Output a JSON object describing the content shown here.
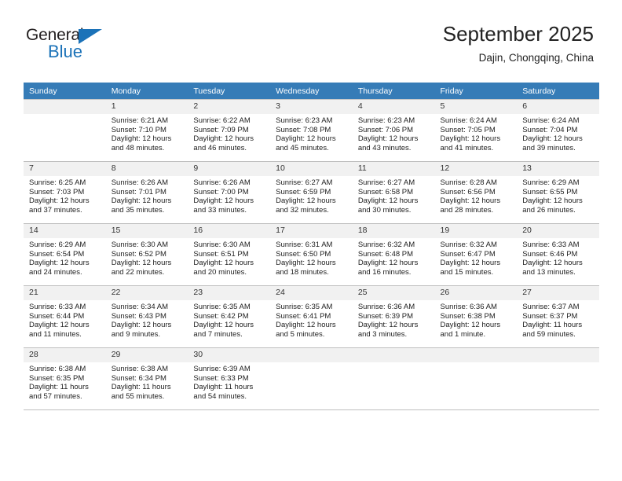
{
  "brand": {
    "name_part1": "General",
    "name_part2": "Blue"
  },
  "header": {
    "title": "September 2025",
    "subtitle": "Dajin, Chongqing, China"
  },
  "weekdays": [
    "Sunday",
    "Monday",
    "Tuesday",
    "Wednesday",
    "Thursday",
    "Friday",
    "Saturday"
  ],
  "labels": {
    "sunrise_prefix": "Sunrise: ",
    "sunset_prefix": "Sunset: ",
    "daylight_prefix": "Daylight: "
  },
  "colors": {
    "header_bar": "#367cb7",
    "brand_blue": "#1b72b8",
    "daynum_bg": "#f1f1f1",
    "grid_line": "#bfbfbf"
  },
  "weeks": [
    [
      {
        "empty": true
      },
      {
        "day": "1",
        "sunrise": "Sunrise: 6:21 AM",
        "sunset": "Sunset: 7:10 PM",
        "daylight_l1": "Daylight: 12 hours",
        "daylight_l2": "and 48 minutes."
      },
      {
        "day": "2",
        "sunrise": "Sunrise: 6:22 AM",
        "sunset": "Sunset: 7:09 PM",
        "daylight_l1": "Daylight: 12 hours",
        "daylight_l2": "and 46 minutes."
      },
      {
        "day": "3",
        "sunrise": "Sunrise: 6:23 AM",
        "sunset": "Sunset: 7:08 PM",
        "daylight_l1": "Daylight: 12 hours",
        "daylight_l2": "and 45 minutes."
      },
      {
        "day": "4",
        "sunrise": "Sunrise: 6:23 AM",
        "sunset": "Sunset: 7:06 PM",
        "daylight_l1": "Daylight: 12 hours",
        "daylight_l2": "and 43 minutes."
      },
      {
        "day": "5",
        "sunrise": "Sunrise: 6:24 AM",
        "sunset": "Sunset: 7:05 PM",
        "daylight_l1": "Daylight: 12 hours",
        "daylight_l2": "and 41 minutes."
      },
      {
        "day": "6",
        "sunrise": "Sunrise: 6:24 AM",
        "sunset": "Sunset: 7:04 PM",
        "daylight_l1": "Daylight: 12 hours",
        "daylight_l2": "and 39 minutes."
      }
    ],
    [
      {
        "day": "7",
        "sunrise": "Sunrise: 6:25 AM",
        "sunset": "Sunset: 7:03 PM",
        "daylight_l1": "Daylight: 12 hours",
        "daylight_l2": "and 37 minutes."
      },
      {
        "day": "8",
        "sunrise": "Sunrise: 6:26 AM",
        "sunset": "Sunset: 7:01 PM",
        "daylight_l1": "Daylight: 12 hours",
        "daylight_l2": "and 35 minutes."
      },
      {
        "day": "9",
        "sunrise": "Sunrise: 6:26 AM",
        "sunset": "Sunset: 7:00 PM",
        "daylight_l1": "Daylight: 12 hours",
        "daylight_l2": "and 33 minutes."
      },
      {
        "day": "10",
        "sunrise": "Sunrise: 6:27 AM",
        "sunset": "Sunset: 6:59 PM",
        "daylight_l1": "Daylight: 12 hours",
        "daylight_l2": "and 32 minutes."
      },
      {
        "day": "11",
        "sunrise": "Sunrise: 6:27 AM",
        "sunset": "Sunset: 6:58 PM",
        "daylight_l1": "Daylight: 12 hours",
        "daylight_l2": "and 30 minutes."
      },
      {
        "day": "12",
        "sunrise": "Sunrise: 6:28 AM",
        "sunset": "Sunset: 6:56 PM",
        "daylight_l1": "Daylight: 12 hours",
        "daylight_l2": "and 28 minutes."
      },
      {
        "day": "13",
        "sunrise": "Sunrise: 6:29 AM",
        "sunset": "Sunset: 6:55 PM",
        "daylight_l1": "Daylight: 12 hours",
        "daylight_l2": "and 26 minutes."
      }
    ],
    [
      {
        "day": "14",
        "sunrise": "Sunrise: 6:29 AM",
        "sunset": "Sunset: 6:54 PM",
        "daylight_l1": "Daylight: 12 hours",
        "daylight_l2": "and 24 minutes."
      },
      {
        "day": "15",
        "sunrise": "Sunrise: 6:30 AM",
        "sunset": "Sunset: 6:52 PM",
        "daylight_l1": "Daylight: 12 hours",
        "daylight_l2": "and 22 minutes."
      },
      {
        "day": "16",
        "sunrise": "Sunrise: 6:30 AM",
        "sunset": "Sunset: 6:51 PM",
        "daylight_l1": "Daylight: 12 hours",
        "daylight_l2": "and 20 minutes."
      },
      {
        "day": "17",
        "sunrise": "Sunrise: 6:31 AM",
        "sunset": "Sunset: 6:50 PM",
        "daylight_l1": "Daylight: 12 hours",
        "daylight_l2": "and 18 minutes."
      },
      {
        "day": "18",
        "sunrise": "Sunrise: 6:32 AM",
        "sunset": "Sunset: 6:48 PM",
        "daylight_l1": "Daylight: 12 hours",
        "daylight_l2": "and 16 minutes."
      },
      {
        "day": "19",
        "sunrise": "Sunrise: 6:32 AM",
        "sunset": "Sunset: 6:47 PM",
        "daylight_l1": "Daylight: 12 hours",
        "daylight_l2": "and 15 minutes."
      },
      {
        "day": "20",
        "sunrise": "Sunrise: 6:33 AM",
        "sunset": "Sunset: 6:46 PM",
        "daylight_l1": "Daylight: 12 hours",
        "daylight_l2": "and 13 minutes."
      }
    ],
    [
      {
        "day": "21",
        "sunrise": "Sunrise: 6:33 AM",
        "sunset": "Sunset: 6:44 PM",
        "daylight_l1": "Daylight: 12 hours",
        "daylight_l2": "and 11 minutes."
      },
      {
        "day": "22",
        "sunrise": "Sunrise: 6:34 AM",
        "sunset": "Sunset: 6:43 PM",
        "daylight_l1": "Daylight: 12 hours",
        "daylight_l2": "and 9 minutes."
      },
      {
        "day": "23",
        "sunrise": "Sunrise: 6:35 AM",
        "sunset": "Sunset: 6:42 PM",
        "daylight_l1": "Daylight: 12 hours",
        "daylight_l2": "and 7 minutes."
      },
      {
        "day": "24",
        "sunrise": "Sunrise: 6:35 AM",
        "sunset": "Sunset: 6:41 PM",
        "daylight_l1": "Daylight: 12 hours",
        "daylight_l2": "and 5 minutes."
      },
      {
        "day": "25",
        "sunrise": "Sunrise: 6:36 AM",
        "sunset": "Sunset: 6:39 PM",
        "daylight_l1": "Daylight: 12 hours",
        "daylight_l2": "and 3 minutes."
      },
      {
        "day": "26",
        "sunrise": "Sunrise: 6:36 AM",
        "sunset": "Sunset: 6:38 PM",
        "daylight_l1": "Daylight: 12 hours",
        "daylight_l2": "and 1 minute."
      },
      {
        "day": "27",
        "sunrise": "Sunrise: 6:37 AM",
        "sunset": "Sunset: 6:37 PM",
        "daylight_l1": "Daylight: 11 hours",
        "daylight_l2": "and 59 minutes."
      }
    ],
    [
      {
        "day": "28",
        "sunrise": "Sunrise: 6:38 AM",
        "sunset": "Sunset: 6:35 PM",
        "daylight_l1": "Daylight: 11 hours",
        "daylight_l2": "and 57 minutes."
      },
      {
        "day": "29",
        "sunrise": "Sunrise: 6:38 AM",
        "sunset": "Sunset: 6:34 PM",
        "daylight_l1": "Daylight: 11 hours",
        "daylight_l2": "and 55 minutes."
      },
      {
        "day": "30",
        "sunrise": "Sunrise: 6:39 AM",
        "sunset": "Sunset: 6:33 PM",
        "daylight_l1": "Daylight: 11 hours",
        "daylight_l2": "and 54 minutes."
      },
      {
        "empty": true
      },
      {
        "empty": true
      },
      {
        "empty": true
      },
      {
        "empty": true
      }
    ]
  ]
}
